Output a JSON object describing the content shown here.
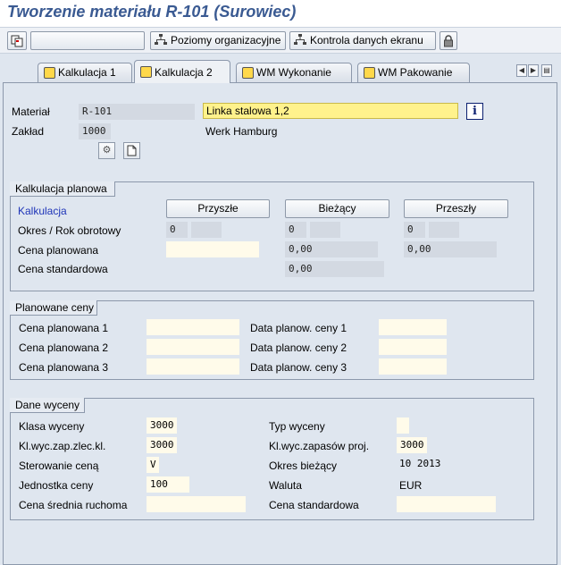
{
  "window": {
    "title": "Tworzenie materiału R-101 (Surowiec)"
  },
  "toolbar": {
    "org_levels_label": "Poziomy organizacyjne",
    "check_data_label": "Kontrola danych ekranu"
  },
  "tabs": [
    {
      "label": "Kalkulacja 1",
      "active": false
    },
    {
      "label": "Kalkulacja 2",
      "active": true
    },
    {
      "label": "WM Wykonanie",
      "active": false
    },
    {
      "label": "WM Pakowanie",
      "active": false
    }
  ],
  "header": {
    "material_label": "Materiał",
    "material_value": "R-101",
    "material_desc": "Linka stalowa 1,2",
    "plant_label": "Zakład",
    "plant_value": "1000",
    "plant_desc": "Werk Hamburg"
  },
  "planned_costing": {
    "title": "Kalkulacja planowa",
    "costing_link": "Kalkulacja",
    "future_btn": "Przyszłe",
    "current_btn": "Bieżący",
    "previous_btn": "Przeszły",
    "period_label": "Okres / Rok obrotowy",
    "future_period": "0",
    "current_period": "0",
    "previous_period": "0",
    "planned_price_label": "Cena planowana",
    "current_planned_price": "0,00",
    "previous_planned_price": "0,00",
    "standard_price_label": "Cena standardowa",
    "current_standard_price": "0,00"
  },
  "planned_prices": {
    "title": "Planowane ceny",
    "price1_label": "Cena planowana 1",
    "price2_label": "Cena planowana 2",
    "price3_label": "Cena planowana 3",
    "date1_label": "Data planow. ceny 1",
    "date2_label": "Data planow. ceny 2",
    "date3_label": "Data planow. ceny 3"
  },
  "valuation": {
    "title": "Dane wyceny",
    "val_class_label": "Klasa wyceny",
    "val_class_value": "3000",
    "so_val_class_label": "Kl.wyc.zap.zlec.kl.",
    "so_val_class_value": "3000",
    "price_control_label": "Sterowanie ceną",
    "price_control_value": "V",
    "price_unit_label": "Jednostka ceny",
    "price_unit_value": "100",
    "moving_avg_label": "Cena średnia ruchoma",
    "val_type_label": "Typ wyceny",
    "proj_val_class_label": "Kl.wyc.zapasów proj.",
    "proj_val_class_value": "3000",
    "current_period_label": "Okres bieżący",
    "current_period_value": "10 2013",
    "currency_label": "Waluta",
    "currency_value": "EUR",
    "standard_price_label": "Cena standardowa"
  }
}
